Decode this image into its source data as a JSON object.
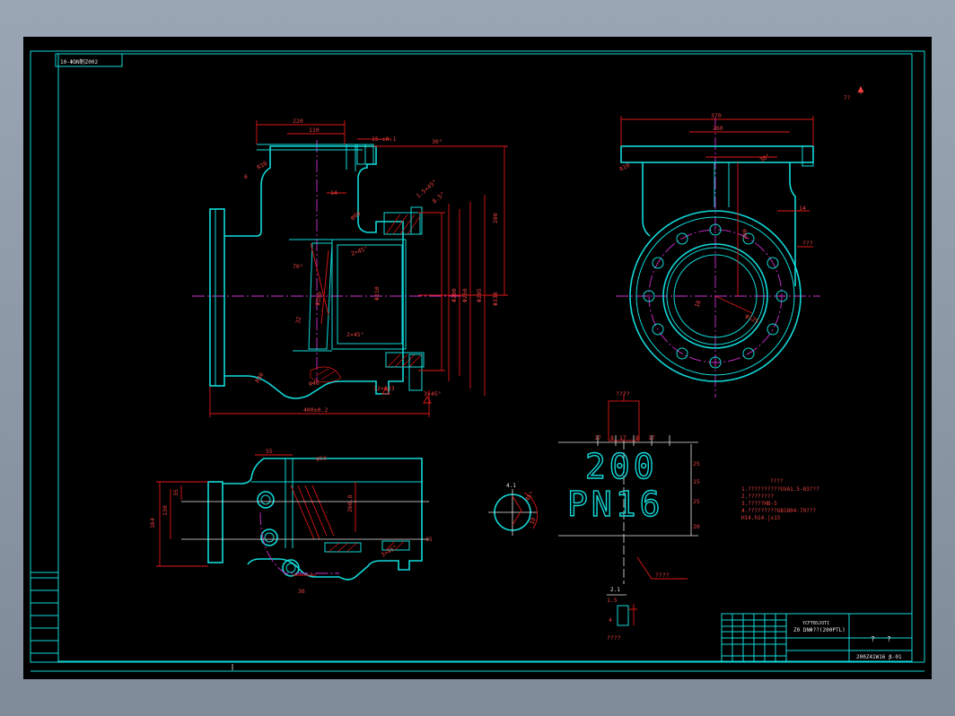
{
  "drawing": {
    "corner_code": "10-ΦDN制Z002",
    "scale_note": "7?",
    "marking": {
      "line1": "200",
      "line2": "PN16"
    }
  },
  "dims_front": {
    "d220": "220",
    "d110": "110",
    "d1530": "15-±0.1",
    "d30": "30°",
    "r10": "R10",
    "d6": "6",
    "d14": "14",
    "d280": "280",
    "dphi280": "Φ280",
    "d1545": "1.5×45°",
    "d85": "8.5°",
    "d60": "φ60",
    "d2x45": "2×45°",
    "d70": "70°",
    "dphi250": "Φ250",
    "dphi210": "Φ210",
    "dphi200": "Φ200",
    "dphi295": "Φ295",
    "dphi338": "Φ338",
    "d32": "32",
    "d12": "12×Φ33",
    "d3x45": "3×45°",
    "d400": "400±0.2",
    "r40": "R40",
    "phi40": "φ40",
    "d2x45b": "2×45°"
  },
  "dims_side": {
    "d370": "370",
    "d260": "260",
    "d30": "30°",
    "r10": "R10",
    "d14": "14",
    "d280": "280",
    "d18": "18",
    "phi125": "φ125",
    "q": "???"
  },
  "dims_top": {
    "d55": "55",
    "phi50": "φ50",
    "d35": "35",
    "d130": "130",
    "d164": "164",
    "d2608": "260.8",
    "d15": "15",
    "d36": "36",
    "d3x45": "3×45°"
  },
  "detail": {
    "d4": "4.1",
    "d45": "45°",
    "d10": "10",
    "q": "????",
    "dims": [
      "17",
      "8",
      "17",
      "8",
      "17"
    ],
    "right": [
      "25",
      "15",
      "25",
      "20"
    ],
    "d21": "2.1",
    "d15": "1.5",
    "d4b": "4"
  },
  "notes": {
    "title": "????",
    "lines": [
      "1.??????????GVA1.5-83???",
      "2.????????",
      "3.?????HB-5",
      "4.?????????GB1804-79???",
      "   H14.h14.js15"
    ]
  },
  "title_block": {
    "doc": "Z0 DNΦ??(200PTL)",
    "sub": "YCFTBSJOTI",
    "code": "200Z41W16 β-01",
    "q1": "?",
    "q2": "?"
  }
}
